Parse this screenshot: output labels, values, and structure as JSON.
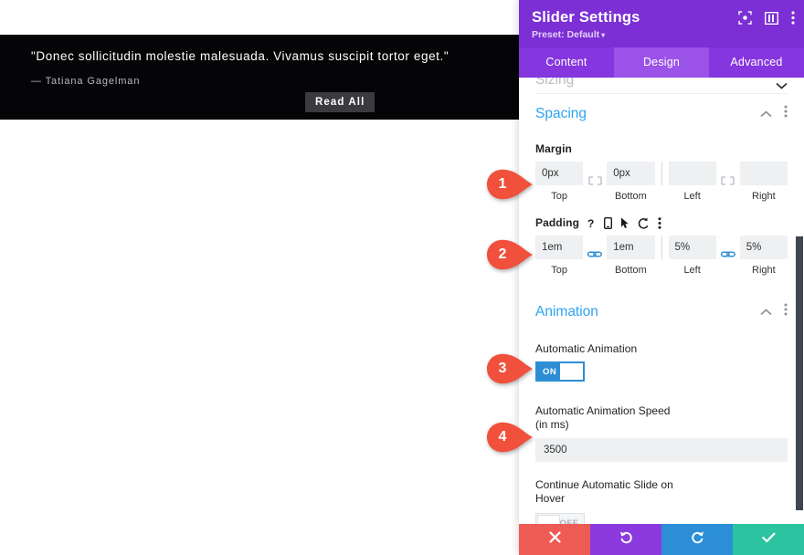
{
  "slider_preview": {
    "quote": "\"Donec sollicitudin molestie malesuada. Vivamus suscipit tortor eget.\"",
    "author": "— Tatiana Gagelman",
    "cta_label": "Read All"
  },
  "panel": {
    "title": "Slider Settings",
    "preset": "Preset: Default",
    "preset_caret": "▾",
    "header_icons": [
      {
        "name": "focus-target-icon"
      },
      {
        "name": "panel-layout-icon"
      },
      {
        "name": "more-options-icon"
      }
    ],
    "tabs": [
      {
        "label": "Content",
        "active": false
      },
      {
        "label": "Design",
        "active": true
      },
      {
        "label": "Advanced",
        "active": false
      }
    ],
    "sections": {
      "sizing": {
        "title": "Sizing",
        "collapsed": true
      },
      "spacing": {
        "title": "Spacing",
        "collapsed": false,
        "margin": {
          "label": "Margin",
          "link_state": "unlinked",
          "fields": [
            {
              "side": "Top",
              "value": "0px",
              "placeholder": ""
            },
            {
              "side": "Bottom",
              "value": "0px",
              "placeholder": ""
            },
            {
              "side": "Left",
              "value": "",
              "placeholder": ""
            },
            {
              "side": "Right",
              "value": "",
              "placeholder": ""
            }
          ]
        },
        "padding": {
          "label": "Padding",
          "link_state": "linked",
          "tool_icons": [
            {
              "name": "help-icon",
              "glyph": "?"
            },
            {
              "name": "responsive-icon",
              "glyph": ""
            },
            {
              "name": "hover-cursor-icon",
              "glyph": ""
            },
            {
              "name": "reset-icon",
              "glyph": ""
            },
            {
              "name": "more-options-icon",
              "glyph": ""
            }
          ],
          "fields": [
            {
              "side": "Top",
              "value": "1em",
              "placeholder": ""
            },
            {
              "side": "Bottom",
              "value": "1em",
              "placeholder": ""
            },
            {
              "side": "Left",
              "value": "5%",
              "placeholder": ""
            },
            {
              "side": "Right",
              "value": "5%",
              "placeholder": ""
            }
          ]
        }
      },
      "animation": {
        "title": "Animation",
        "collapsed": false,
        "automatic_animation": {
          "label": "Automatic Animation",
          "state": "ON"
        },
        "animation_speed": {
          "label_line1": "Automatic Animation Speed",
          "label_line2": "(in ms)",
          "value": "3500"
        },
        "continue_on_hover": {
          "label_line1": "Continue Automatic Slide on",
          "label_line2": "Hover",
          "state": "OFF"
        }
      }
    },
    "footer": [
      {
        "name": "cancel-button",
        "icon": "close-icon"
      },
      {
        "name": "undo-button",
        "icon": "undo-icon"
      },
      {
        "name": "redo-button",
        "icon": "redo-icon"
      },
      {
        "name": "save-button",
        "icon": "check-icon"
      }
    ]
  },
  "step_markers": [
    {
      "number": "1",
      "target": "margin-fields"
    },
    {
      "number": "2",
      "target": "padding-fields"
    },
    {
      "number": "3",
      "target": "automatic-animation-toggle"
    },
    {
      "number": "4",
      "target": "animation-speed-input"
    }
  ],
  "colors": {
    "panel_header": "#7b2fd4",
    "tab_bar": "#8536de",
    "tab_active": "#9a52e8",
    "section_title": "#2ea3f2",
    "toggle_on": "#2d8ed4",
    "marker": "#f0503c",
    "footer_cancel": "#ed5b55",
    "footer_undo": "#8c3ae0",
    "footer_redo": "#2b8ed6",
    "footer_save": "#2cc3a0"
  }
}
